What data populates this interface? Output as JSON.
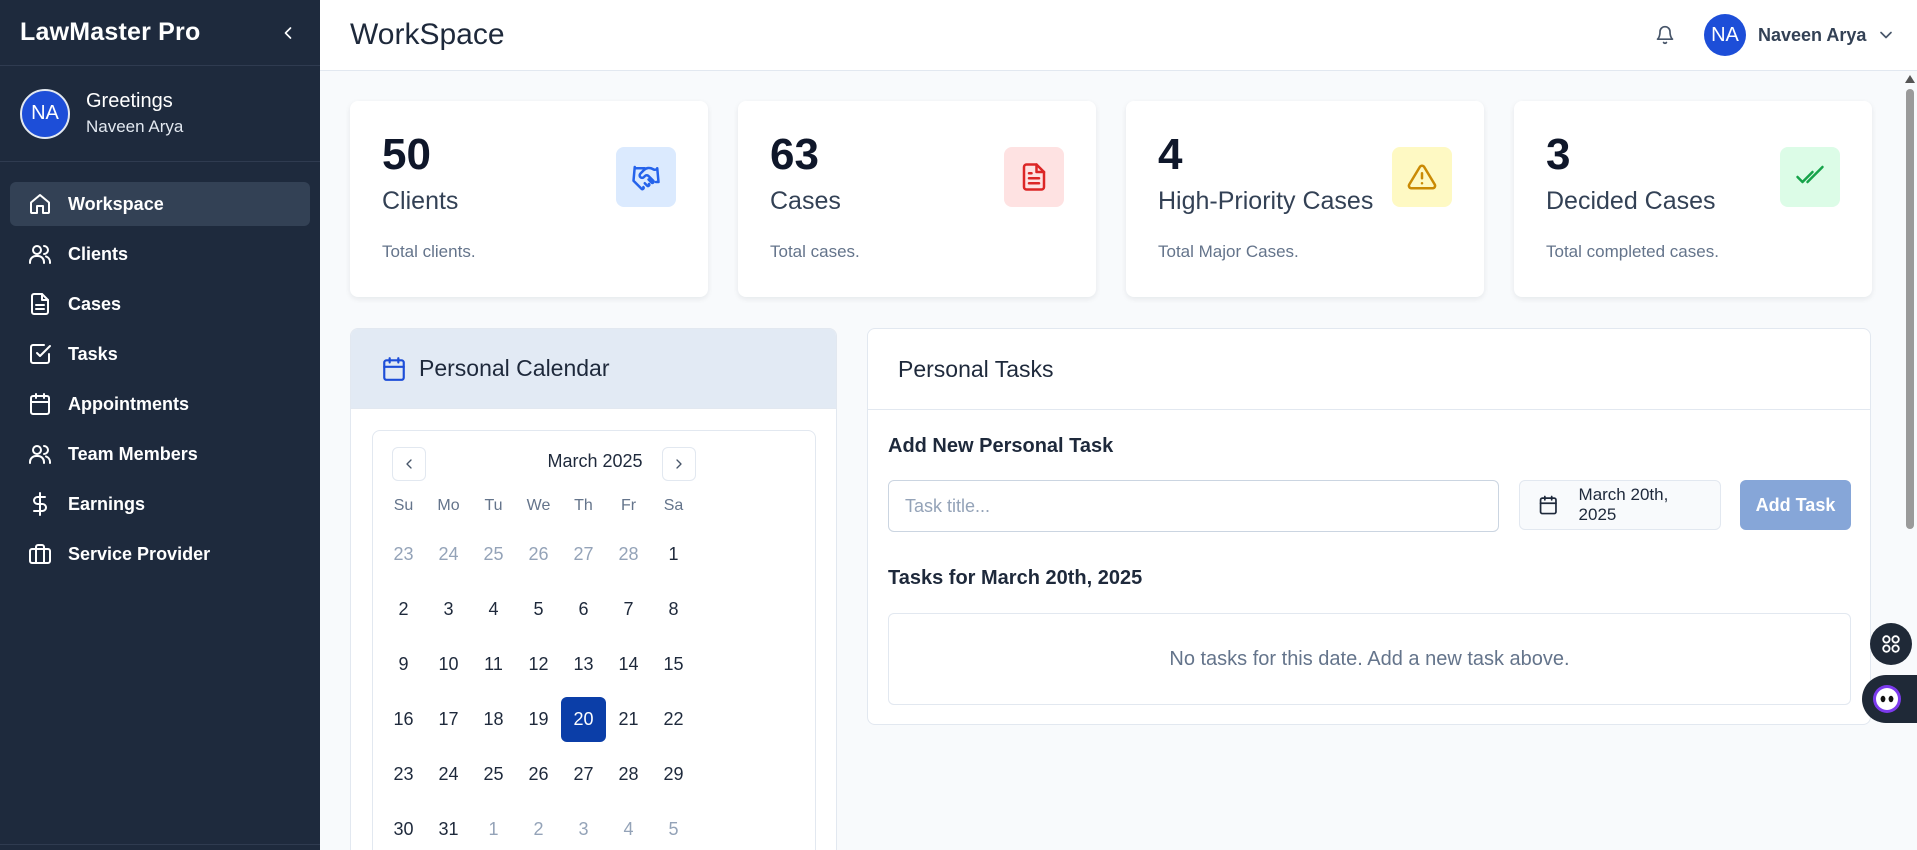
{
  "app": {
    "name": "LawMaster Pro"
  },
  "greeting": {
    "title": "Greetings",
    "name": "Naveen Arya",
    "initials": "NA"
  },
  "nav": [
    {
      "label": "Workspace",
      "icon": "home-icon",
      "active": true
    },
    {
      "label": "Clients",
      "icon": "users-icon"
    },
    {
      "label": "Cases",
      "icon": "file-icon"
    },
    {
      "label": "Tasks",
      "icon": "check-square-icon"
    },
    {
      "label": "Appointments",
      "icon": "calendar-icon"
    },
    {
      "label": "Team Members",
      "icon": "team-icon"
    },
    {
      "label": "Earnings",
      "icon": "dollar-icon"
    },
    {
      "label": "Service Provider",
      "icon": "briefcase-icon"
    }
  ],
  "header": {
    "title": "WorkSpace",
    "user_name": "Naveen Arya",
    "user_initials": "NA"
  },
  "stats": [
    {
      "value": "50",
      "label": "Clients",
      "desc": "Total clients.",
      "icon": "handshake-icon",
      "icon_bg": "#dbeafe",
      "icon_color": "#2563eb"
    },
    {
      "value": "63",
      "label": "Cases",
      "desc": "Total cases.",
      "icon": "document-icon",
      "icon_bg": "#fee2e2",
      "icon_color": "#dc2626"
    },
    {
      "value": "4",
      "label": "High-Priority Cases",
      "desc": "Total Major Cases.",
      "icon": "warning-icon",
      "icon_bg": "#fef9c3",
      "icon_color": "#ca8a04"
    },
    {
      "value": "3",
      "label": "Decided Cases",
      "desc": "Total completed cases.",
      "icon": "double-check-icon",
      "icon_bg": "#dcfce7",
      "icon_color": "#16a34a"
    }
  ],
  "calendar": {
    "title": "Personal Calendar",
    "month": "March 2025",
    "weekdays": [
      "Su",
      "Mo",
      "Tu",
      "We",
      "Th",
      "Fr",
      "Sa"
    ],
    "weeks": [
      [
        [
          "23",
          1
        ],
        [
          "24",
          1
        ],
        [
          "25",
          1
        ],
        [
          "26",
          1
        ],
        [
          "27",
          1
        ],
        [
          "28",
          1
        ],
        [
          "1",
          0
        ]
      ],
      [
        [
          "2",
          0
        ],
        [
          "3",
          0
        ],
        [
          "4",
          0
        ],
        [
          "5",
          0
        ],
        [
          "6",
          0
        ],
        [
          "7",
          0
        ],
        [
          "8",
          0
        ]
      ],
      [
        [
          "9",
          0
        ],
        [
          "10",
          0
        ],
        [
          "11",
          0
        ],
        [
          "12",
          0
        ],
        [
          "13",
          0
        ],
        [
          "14",
          0
        ],
        [
          "15",
          0
        ]
      ],
      [
        [
          "16",
          0
        ],
        [
          "17",
          0
        ],
        [
          "18",
          0
        ],
        [
          "19",
          0
        ],
        [
          "20",
          2
        ],
        [
          "21",
          0
        ],
        [
          "22",
          0
        ]
      ],
      [
        [
          "23",
          0
        ],
        [
          "24",
          0
        ],
        [
          "25",
          0
        ],
        [
          "26",
          0
        ],
        [
          "27",
          0
        ],
        [
          "28",
          0
        ],
        [
          "29",
          0
        ]
      ],
      [
        [
          "30",
          0
        ],
        [
          "31",
          0
        ],
        [
          "1",
          1
        ],
        [
          "2",
          1
        ],
        [
          "3",
          1
        ],
        [
          "4",
          1
        ],
        [
          "5",
          1
        ]
      ]
    ]
  },
  "tasks": {
    "title": "Personal Tasks",
    "add_label": "Add New Personal Task",
    "input_placeholder": "Task title...",
    "date_value": "March 20th, 2025",
    "add_button": "Add Task",
    "list_title": "Tasks for March 20th, 2025",
    "empty_message": "No tasks for this date. Add a new task above."
  }
}
